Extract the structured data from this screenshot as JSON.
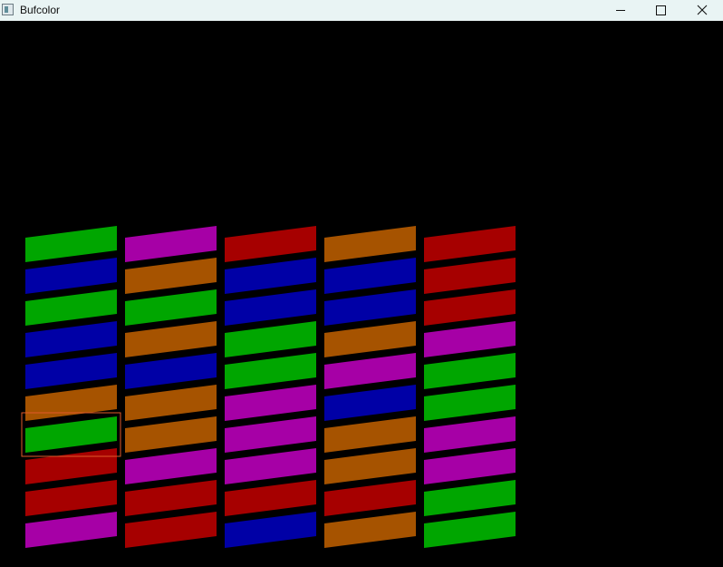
{
  "window": {
    "title": "Bufcolor",
    "icon": "app-window-icon",
    "controls": [
      {
        "name": "minimize",
        "icon": "minimize-icon"
      },
      {
        "name": "maximize",
        "icon": "maximize-icon"
      },
      {
        "name": "close",
        "icon": "close-icon"
      }
    ]
  },
  "palette": {
    "G": "#00a600",
    "B": "#0000a6",
    "M": "#a600a6",
    "O": "#a65300",
    "R": "#a60000",
    "outline": "#e05a2a"
  },
  "grid": {
    "columns": [
      [
        "G",
        "B",
        "G",
        "B",
        "B",
        "O",
        "G",
        "R",
        "R",
        "M"
      ],
      [
        "M",
        "O",
        "G",
        "O",
        "B",
        "O",
        "O",
        "M",
        "R",
        "R"
      ],
      [
        "R",
        "B",
        "B",
        "G",
        "G",
        "M",
        "M",
        "M",
        "R",
        "B"
      ],
      [
        "O",
        "B",
        "B",
        "O",
        "M",
        "B",
        "O",
        "O",
        "R",
        "O"
      ],
      [
        "R",
        "R",
        "R",
        "M",
        "G",
        "G",
        "M",
        "M",
        "G",
        "G"
      ]
    ],
    "selected": {
      "column": 0,
      "row": 6
    }
  }
}
